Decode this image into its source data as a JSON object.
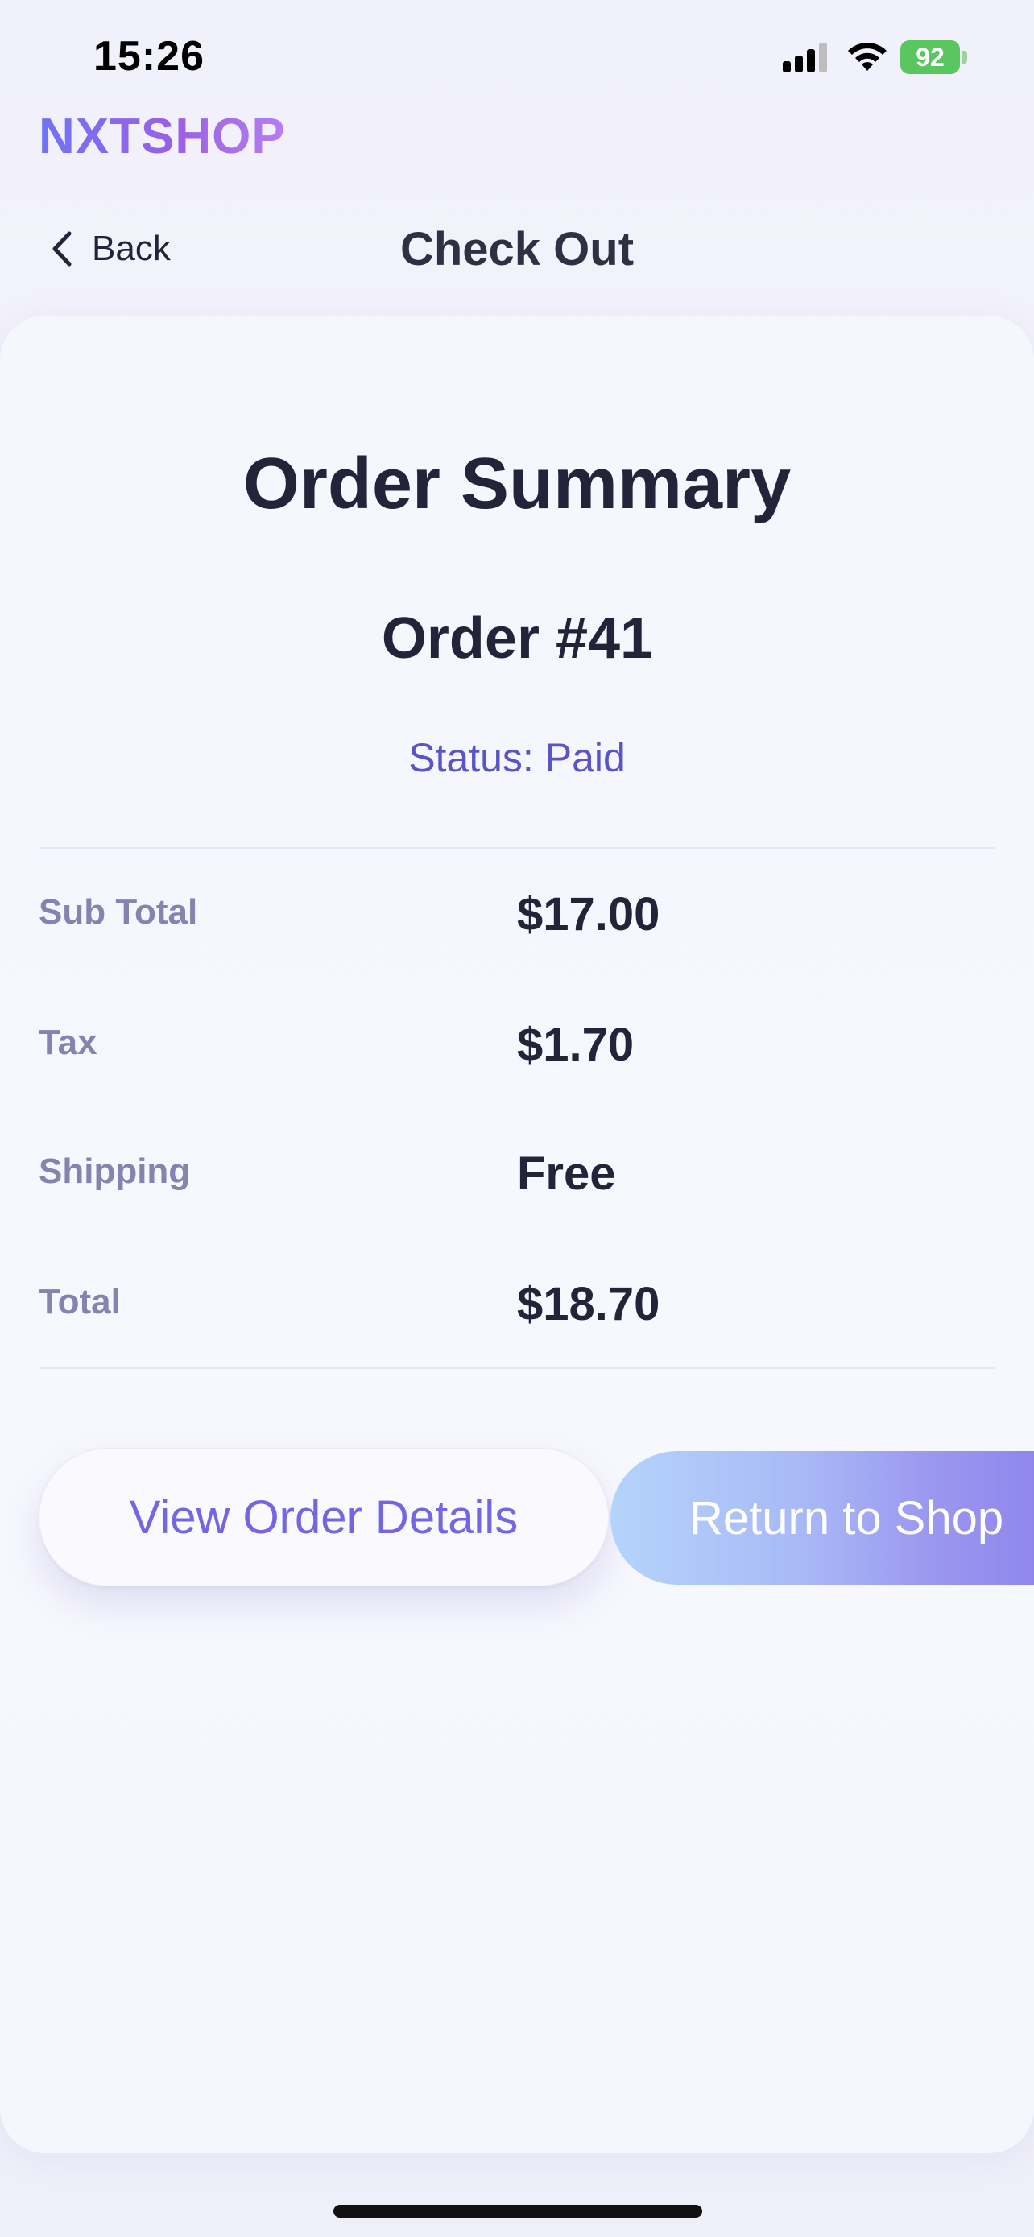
{
  "status_bar": {
    "time": "15:26",
    "battery_level": "92",
    "icons": [
      "signal-icon",
      "wifi-icon",
      "battery-icon"
    ]
  },
  "brand": {
    "logo_text": "NXTSHOP"
  },
  "nav": {
    "back_label": "Back",
    "title": "Check Out"
  },
  "summary": {
    "title": "Order Summary",
    "order_number": "Order #41",
    "status": "Status: Paid",
    "rows": [
      {
        "label": "Sub Total",
        "value": "$17.00"
      },
      {
        "label": "Tax",
        "value": "$1.70"
      },
      {
        "label": "Shipping",
        "value": "Free"
      },
      {
        "label": "Total",
        "value": "$18.70"
      }
    ]
  },
  "actions": {
    "view_details_label": "View Order Details",
    "return_shop_label": "Return to Shop"
  },
  "colors": {
    "accent": "#7465e2",
    "status_text": "#5a55c6",
    "label_text": "#8683b0",
    "battery": "#5ac65f"
  }
}
